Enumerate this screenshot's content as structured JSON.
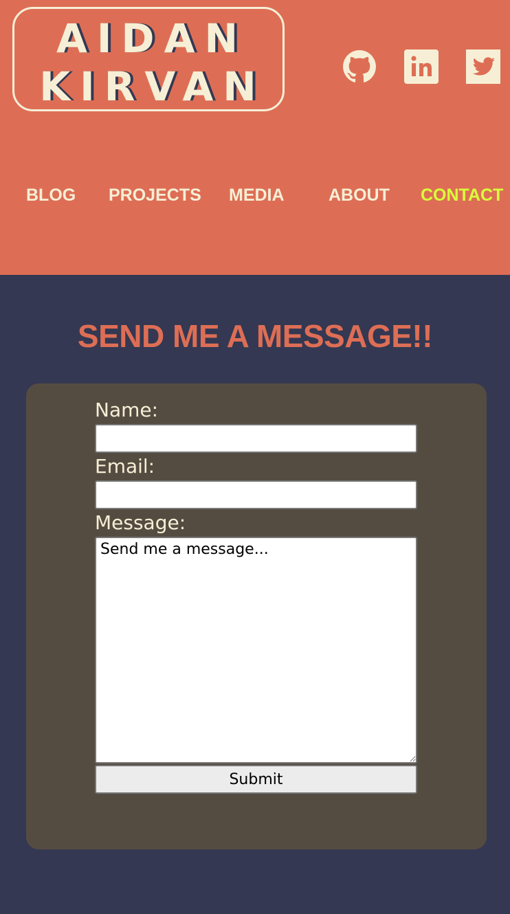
{
  "logo": {
    "line1": "AIDAN",
    "line2": "KIRVAN"
  },
  "social": [
    {
      "name": "GitHub",
      "icon": "github-icon"
    },
    {
      "name": "LinkedIn",
      "icon": "linkedin-icon"
    },
    {
      "name": "Twitter",
      "icon": "twitter-icon"
    }
  ],
  "nav": {
    "blog": "BLOG",
    "projects": "PROJECTS",
    "media": "MEDIA",
    "about": "ABOUT",
    "contact": "CONTACT",
    "active": "contact"
  },
  "contact": {
    "heading": "SEND ME A MESSAGE!!",
    "name_label": "Name:",
    "name_value": "",
    "email_label": "Email:",
    "email_value": "",
    "message_label": "Message:",
    "message_placeholder": "Send me a message...",
    "submit_label": "Submit"
  },
  "colors": {
    "header_bg": "#dd6e55",
    "page_bg": "#343852",
    "card_bg": "#554c41",
    "cream": "#f6efd6",
    "active_nav": "#d8ff3a"
  }
}
